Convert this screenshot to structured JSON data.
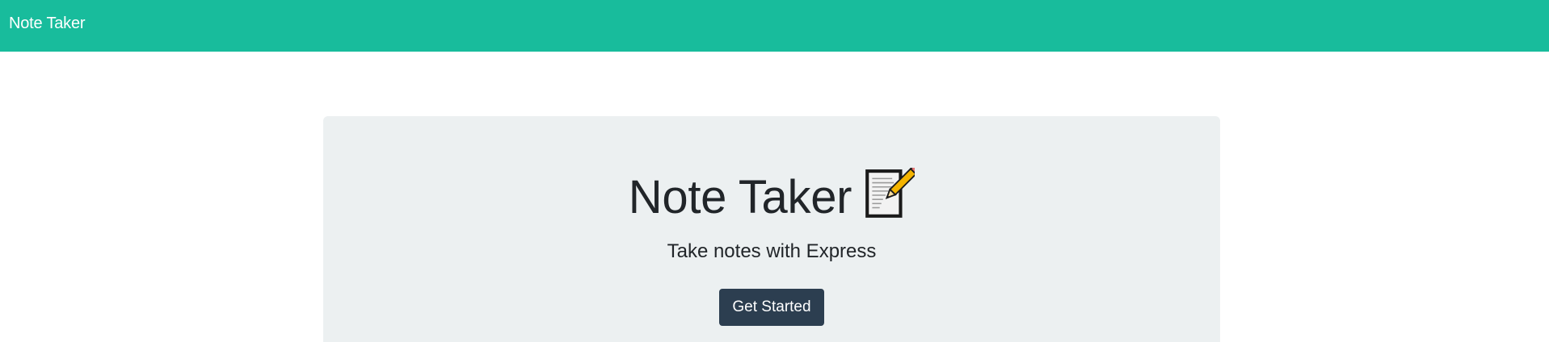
{
  "navbar": {
    "brand": "Note Taker",
    "color": "#18bc9c"
  },
  "hero": {
    "title": "Note Taker",
    "title_icon": "memo-icon",
    "lead": "Take notes with Express",
    "cta_label": "Get Started",
    "background": "#ecf0f1",
    "button_color": "#2c3e50"
  }
}
